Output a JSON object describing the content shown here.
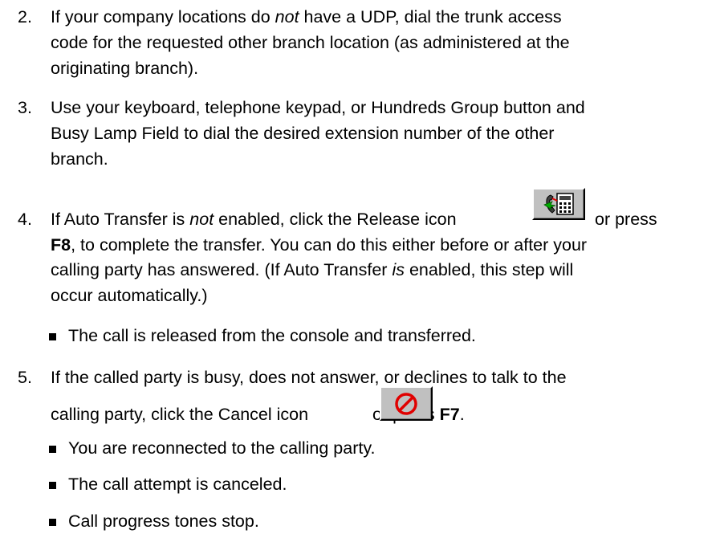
{
  "steps": [
    {
      "number": "2.",
      "lines": [
        {
          "a": "If your company locations do ",
          "em": "not",
          "b": " have a UDP, dial the trunk access"
        },
        {
          "text": "code for the requested other branch location (as administered at the"
        },
        {
          "text": "originating branch)."
        }
      ]
    },
    {
      "number": "3.",
      "lines": [
        {
          "text": "Use your keyboard, telephone keypad, or Hundreds Group button and"
        },
        {
          "text": "Busy Lamp Field to dial the desired extension number of the other"
        },
        {
          "text": "branch."
        }
      ]
    },
    {
      "number": "4.",
      "line1": {
        "a": "If Auto Transfer is ",
        "em": "not",
        "b": " enabled, click the Release icon ",
        "c": " or press"
      },
      "line2": {
        "key": "F8",
        "rest": ", to complete the transfer.  You can do this either before or after your"
      },
      "line3": {
        "a": "calling party has answered.  (If Auto Transfer ",
        "em": "is",
        "b": " enabled, this step will"
      },
      "line4": {
        "text": "occur automatically.)"
      },
      "bullets": [
        "The call is released from the console and transferred."
      ]
    },
    {
      "number": "5.",
      "line1": {
        "text": "If the called party is busy, does not answer, or declines to talk to the"
      },
      "line2": {
        "a": "calling party, click the Cancel icon ",
        "b": " or press ",
        "key": "F7",
        "c": "."
      },
      "bullets": [
        "You are reconnected to the calling party.",
        "The call attempt is canceled.",
        "Call progress tones stop."
      ]
    }
  ],
  "icons": {
    "release": "release-phone-icon",
    "cancel": "cancel-circle-slash-icon",
    "cancel_color": "#e00000",
    "release_color": "#00aa00"
  }
}
